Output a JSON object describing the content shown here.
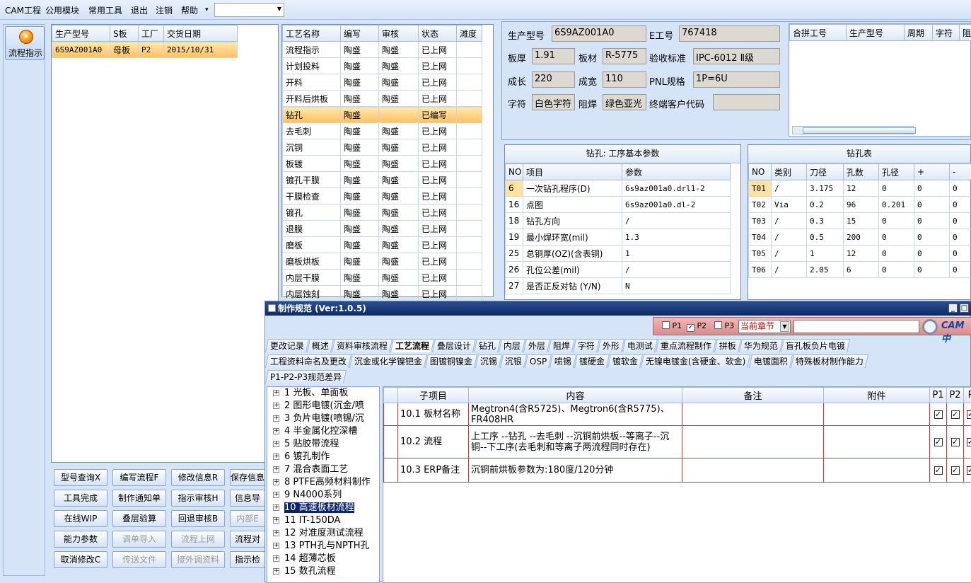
{
  "menu": {
    "items": [
      "CAM工程",
      "公用模块",
      "常用工具",
      "退出",
      "注销",
      "帮助"
    ],
    "arrow": "▾",
    "combo_value": ""
  },
  "sidebar": {
    "flow_button": "流程指示",
    "flow_icon_glyph": "⏸"
  },
  "orders": {
    "headers": [
      "生产型号",
      "S板",
      "工厂",
      "交货日期"
    ],
    "rows": [
      [
        "6S9AZ001A0",
        "母板",
        "P2",
        "2015/10/31"
      ]
    ]
  },
  "process": {
    "headers": [
      "工艺名称",
      "编写",
      "审核",
      "状态",
      "滩度"
    ],
    "rows": [
      [
        "流程指示",
        "陶盛",
        "陶盛",
        "已上网",
        ""
      ],
      [
        "计划投料",
        "陶盛",
        "陶盛",
        "已上网",
        ""
      ],
      [
        "开料",
        "陶盛",
        "陶盛",
        "已上网",
        ""
      ],
      [
        "开料后烘板",
        "陶盛",
        "陶盛",
        "已上网",
        ""
      ],
      [
        "钻孔",
        "陶盛",
        "",
        "已编写",
        ""
      ],
      [
        "去毛刺",
        "陶盛",
        "陶盛",
        "已上网",
        ""
      ],
      [
        "沉铜",
        "陶盛",
        "陶盛",
        "已上网",
        ""
      ],
      [
        "板镀",
        "陶盛",
        "陶盛",
        "已上网",
        ""
      ],
      [
        "镀孔干膜",
        "陶盛",
        "陶盛",
        "已上网",
        ""
      ],
      [
        "干膜检查",
        "陶盛",
        "陶盛",
        "已上网",
        ""
      ],
      [
        "镀孔",
        "陶盛",
        "陶盛",
        "已上网",
        ""
      ],
      [
        "退膜",
        "陶盛",
        "陶盛",
        "已上网",
        ""
      ],
      [
        "磨板",
        "陶盛",
        "陶盛",
        "已上网",
        ""
      ],
      [
        "磨板烘板",
        "陶盛",
        "陶盛",
        "已上网",
        ""
      ],
      [
        "内层干膜",
        "陶盛",
        "陶盛",
        "已上网",
        ""
      ],
      [
        "内层蚀刻",
        "陶盛",
        "陶盛",
        "已上网",
        ""
      ]
    ],
    "selected_index": 4
  },
  "info": {
    "prod_model_label": "生产型号",
    "prod_model": "6S9AZ001A0",
    "e_no_label": "E工号",
    "e_no": "767418",
    "thickness_label": "板厚",
    "thickness": "1.91",
    "material_label": "板材",
    "material": "R-5775",
    "standard_label": "验收标准",
    "standard": "IPC-6012 Ⅱ级",
    "length_label": "成长",
    "length": "220",
    "width_label": "成宽",
    "width": "110",
    "pnl_label": "PNL规格",
    "pnl": "1P=6U",
    "char_label": "字符",
    "char_value": "白色字符",
    "mask_label": "阻焊",
    "mask_value": "绿色亚光",
    "customer_label": "终端客户代码",
    "customer": ""
  },
  "merge": {
    "headers": [
      "合拼工号",
      "生产型号",
      "周期",
      "字符",
      "阻"
    ]
  },
  "drill_params": {
    "title": "钻孔: 工序基本参数",
    "headers": [
      "NO",
      "项目",
      "参数"
    ],
    "rows": [
      [
        "6",
        "一次钻孔程序(D)",
        "6s9az001a0.drl1-2"
      ],
      [
        "16",
        "点图",
        "6s9az001a0.dl-2"
      ],
      [
        "18",
        "钻孔方向",
        "/"
      ],
      [
        "19",
        "最小焊环宽(mil)",
        "1.3"
      ],
      [
        "25",
        "总铜厚(OZ)(含表铜)",
        "1"
      ],
      [
        "26",
        "孔位公差(mil)",
        "/"
      ],
      [
        "27",
        "是否正反对钻 (Y/N)",
        "N"
      ]
    ]
  },
  "drill_table": {
    "title": "钻孔表",
    "headers": [
      "NO",
      "类别",
      "刀径",
      "孔数",
      "孔径",
      "+",
      "-"
    ],
    "rows": [
      [
        "T01",
        "/",
        "3.175",
        "12",
        "0",
        "0",
        "0"
      ],
      [
        "T02",
        "Via",
        "0.2",
        "96",
        "0.201",
        "0",
        "0"
      ],
      [
        "T03",
        "/",
        "0.3",
        "15",
        "0",
        "0",
        "0"
      ],
      [
        "T04",
        "/",
        "0.5",
        "200",
        "0",
        "0",
        "0"
      ],
      [
        "T05",
        "/",
        "1",
        "12",
        "0",
        "0",
        "0"
      ],
      [
        "T06",
        "/",
        "2.05",
        "6",
        "0",
        "0",
        "0"
      ]
    ]
  },
  "buttons": [
    [
      "型号查询X",
      "编写流程F",
      "修改信息R",
      "保存信息"
    ],
    [
      "工具完成",
      "制作通知单",
      "指示审核H",
      "信息导"
    ],
    [
      "在线WIP",
      "叠层验算",
      "回退审核B",
      "内部E"
    ],
    [
      "能力参数",
      "调单导入",
      "流程上网",
      "流程对"
    ],
    [
      "取消修改C",
      "传送文件",
      "接外调资料",
      "指示检"
    ]
  ],
  "buttons_disabled": [
    [
      false,
      false,
      false,
      false
    ],
    [
      false,
      false,
      false,
      false
    ],
    [
      false,
      false,
      false,
      true
    ],
    [
      false,
      true,
      true,
      false
    ],
    [
      false,
      true,
      true,
      false
    ]
  ],
  "spec": {
    "title": "制作规范 (Ver:1.0.5)",
    "p1": "P1",
    "p2": "P2",
    "p3": "P3",
    "chapter": "当前章节",
    "brand": "CAM中",
    "tabs_row1": [
      "更改记录",
      "概述",
      "资料审核流程",
      "工艺流程",
      "叠层设计",
      "钻孔",
      "内层",
      "外层",
      "阻焊",
      "字符",
      "外形",
      "电测试",
      "重点流程制作",
      "拼板",
      "华为规范",
      "盲孔板负片电镀"
    ],
    "tabs_row2": [
      "工程资料命名及更改",
      "沉金或化学镍钯金",
      "图镀铜镍金",
      "沉锡",
      "沉银",
      "OSP",
      "喷锡",
      "镀硬金",
      "镀软金",
      "无镍电镀金(含硬金、软金)",
      "电镀面积",
      "特殊板材制作能力"
    ],
    "tabs_row3": [
      "P1-P2-P3规范差异"
    ],
    "active_tab": "工艺流程",
    "tree": [
      "1 光板、单面板",
      "2 图形电镀(沉金/喷",
      "3 负片电镀(喷锡/沉",
      "4 半金属化控深槽",
      "5 贴胶带流程",
      "6 镀孔制作",
      "7 混合表面工艺",
      "8 PTFE高频材料制作",
      "9 N4000系列",
      "10 高速板材流程",
      "11 IT-150DA",
      "12 对准度测试流程",
      "13 PTH孔与NPTH孔",
      "14 超薄芯板",
      "15 数孔流程"
    ],
    "tree_selected": 9,
    "grid_headers": [
      "子项目",
      "内容",
      "备注",
      "附件",
      "P1",
      "P2",
      "P"
    ],
    "grid_rows": [
      [
        "10.1 板材名称",
        "Megtron4(含R5725)、Megtron6(含R5775)、FR408HR",
        "",
        ""
      ],
      [
        "10.2 流程",
        "上工序 --钻孔 --去毛刺 --沉铜前烘板--等离子--沉铜--下工序(去毛刺和等离子两流程同时存在)",
        "",
        ""
      ],
      [
        "10.3 ERP备注",
        "沉铜前烘板参数为:180度/120分钟",
        "",
        ""
      ]
    ]
  }
}
